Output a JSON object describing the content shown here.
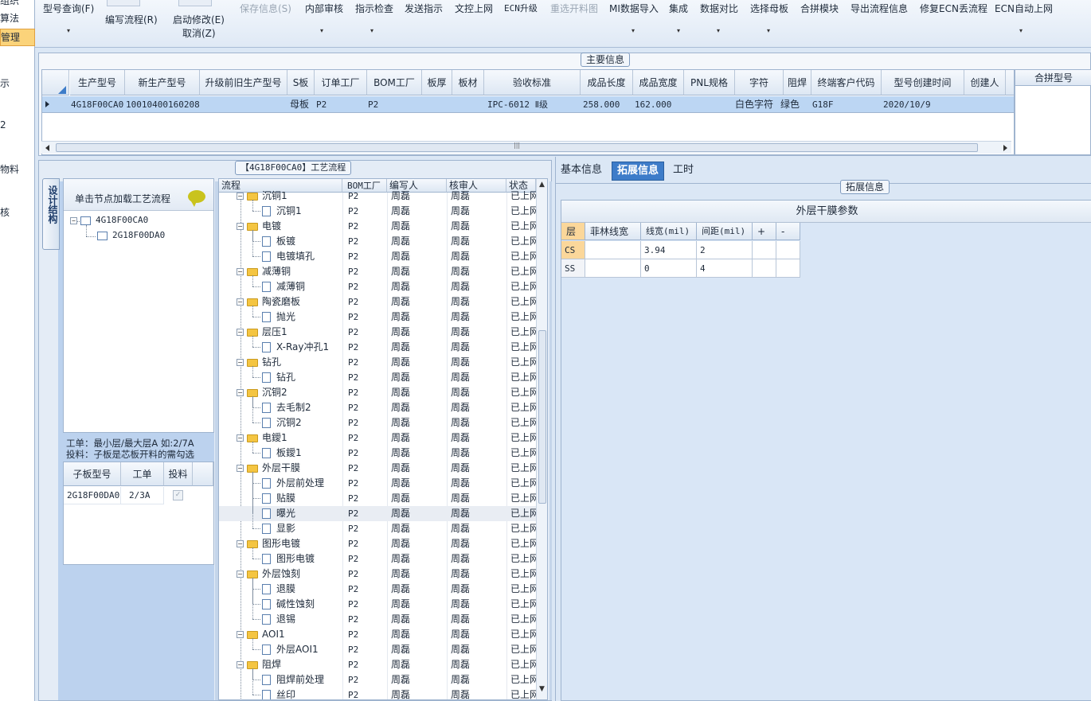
{
  "left_strip": {
    "items": [
      "组织",
      "算法",
      "管理",
      "示",
      "2",
      "物料",
      "核"
    ]
  },
  "toolbar": {
    "model_query": "型号查询(F)",
    "write_flow": "编写流程(R)",
    "start_edit": "启动修改(E)",
    "cancel": "取消(Z)",
    "save_info": "保存信息(S)",
    "internal_audit": "内部审核",
    "instruction_check": "指示检查",
    "send_instruction": "发送指示",
    "doc_control_online": "文控上网",
    "ecn_upgrade": "ECN升级",
    "reselect_cutting": "重选开料图",
    "mi_import": "MI数据导入",
    "integrate": "集成",
    "data_compare": "数据对比",
    "select_mother": "选择母板",
    "merge_module": "合拼模块",
    "export_flow": "导出流程信息",
    "fix_ecn": "修复ECN丢流程",
    "ecn_auto_online": "ECN自动上网",
    "dropdown_glyph": "▾"
  },
  "main_info": {
    "title": "主要信息",
    "columns": [
      "生产型号",
      "新生产型号",
      "升级前旧生产型号",
      "S板",
      "订单工厂",
      "BOM工厂",
      "板厚",
      "板材",
      "验收标准",
      "成品长度",
      "成品宽度",
      "PNL规格",
      "字符",
      "阻焊",
      "终端客户代码",
      "型号创建时间",
      "创建人"
    ],
    "row": {
      "model": "4G18F00CA0",
      "new_model": "10010400160208",
      "s_board": "母板",
      "order_factory": "P2",
      "bom_factory": "P2",
      "standard": "IPC-6012 Ⅱ级",
      "length": "258.000",
      "width": "162.000",
      "char": "白色字符",
      "solder": "绿色",
      "customer_code": "G18F",
      "create_time": "2020/10/9"
    },
    "merge_title": "合拼型号",
    "scroll_grip": "|||"
  },
  "process": {
    "panel_title": "【4G18F00CA0】工艺流程",
    "vertical_tab": "设计结构",
    "tree_header": "单击节点加载工艺流程",
    "tree_root": "4G18F00CA0",
    "tree_child": "2G18F00DA0",
    "tree_toggle": "−",
    "note_line1": "工单：最小层/最大层A 如:2/7A",
    "note_line2": "投料：子板是芯板开料的需勾选",
    "sub_columns": [
      "子板型号",
      "工单",
      "投料"
    ],
    "sub_row": {
      "model": "2G18F00DA0",
      "order": "2/3A",
      "check": "✓"
    },
    "flow_columns": [
      "流程",
      "BOM工厂",
      "编写人",
      "核审人",
      "状态"
    ],
    "flow_toggle": "−",
    "scroll_up": "▲",
    "scroll_down": "▼",
    "flow_rows": [
      {
        "name": "沉铜1",
        "folder": true,
        "factory": "P2",
        "writer": "周磊",
        "reviewer": "周磊",
        "status": "已上网"
      },
      {
        "name": "沉铜1",
        "folder": false,
        "factory": "P2",
        "writer": "周磊",
        "reviewer": "周磊",
        "status": "已上网"
      },
      {
        "name": "电镀",
        "folder": true,
        "factory": "P2",
        "writer": "周磊",
        "reviewer": "周磊",
        "status": "已上网"
      },
      {
        "name": "板镀",
        "folder": false,
        "factory": "P2",
        "writer": "周磊",
        "reviewer": "周磊",
        "status": "已上网"
      },
      {
        "name": "电镀填孔",
        "folder": false,
        "factory": "P2",
        "writer": "周磊",
        "reviewer": "周磊",
        "status": "已上网"
      },
      {
        "name": "减薄铜",
        "folder": true,
        "factory": "P2",
        "writer": "周磊",
        "reviewer": "周磊",
        "status": "已上网"
      },
      {
        "name": "减薄铜",
        "folder": false,
        "factory": "P2",
        "writer": "周磊",
        "reviewer": "周磊",
        "status": "已上网"
      },
      {
        "name": "陶瓷磨板",
        "folder": true,
        "factory": "P2",
        "writer": "周磊",
        "reviewer": "周磊",
        "status": "已上网"
      },
      {
        "name": "抛光",
        "folder": false,
        "factory": "P2",
        "writer": "周磊",
        "reviewer": "周磊",
        "status": "已上网"
      },
      {
        "name": "层压1",
        "folder": true,
        "factory": "P2",
        "writer": "周磊",
        "reviewer": "周磊",
        "status": "已上网"
      },
      {
        "name": "X-Ray冲孔1",
        "folder": false,
        "factory": "P2",
        "writer": "周磊",
        "reviewer": "周磊",
        "status": "已上网"
      },
      {
        "name": "钻孔",
        "folder": true,
        "factory": "P2",
        "writer": "周磊",
        "reviewer": "周磊",
        "status": "已上网"
      },
      {
        "name": "钻孔",
        "folder": false,
        "factory": "P2",
        "writer": "周磊",
        "reviewer": "周磊",
        "status": "已上网"
      },
      {
        "name": "沉铜2",
        "folder": true,
        "factory": "P2",
        "writer": "周磊",
        "reviewer": "周磊",
        "status": "已上网"
      },
      {
        "name": "去毛制2",
        "folder": false,
        "factory": "P2",
        "writer": "周磊",
        "reviewer": "周磊",
        "status": "已上网"
      },
      {
        "name": "沉铜2",
        "folder": false,
        "factory": "P2",
        "writer": "周磊",
        "reviewer": "周磊",
        "status": "已上网"
      },
      {
        "name": "电鑀1",
        "folder": true,
        "factory": "P2",
        "writer": "周磊",
        "reviewer": "周磊",
        "status": "已上网"
      },
      {
        "name": "板鑀1",
        "folder": false,
        "factory": "P2",
        "writer": "周磊",
        "reviewer": "周磊",
        "status": "已上网"
      },
      {
        "name": "外层干膜",
        "folder": true,
        "factory": "P2",
        "writer": "周磊",
        "reviewer": "周磊",
        "status": "已上网"
      },
      {
        "name": "外层前处理",
        "folder": false,
        "factory": "P2",
        "writer": "周磊",
        "reviewer": "周磊",
        "status": "已上网"
      },
      {
        "name": "贴膜",
        "folder": false,
        "factory": "P2",
        "writer": "周磊",
        "reviewer": "周磊",
        "status": "已上网"
      },
      {
        "name": "曝光",
        "folder": false,
        "factory": "P2",
        "writer": "周磊",
        "reviewer": "周磊",
        "status": "已上网",
        "selected": true
      },
      {
        "name": "显影",
        "folder": false,
        "factory": "P2",
        "writer": "周磊",
        "reviewer": "周磊",
        "status": "已上网"
      },
      {
        "name": "图形电镀",
        "folder": true,
        "factory": "P2",
        "writer": "周磊",
        "reviewer": "周磊",
        "status": "已上网"
      },
      {
        "name": "图形电镀",
        "folder": false,
        "factory": "P2",
        "writer": "周磊",
        "reviewer": "周磊",
        "status": "已上网"
      },
      {
        "name": "外层蚀刻",
        "folder": true,
        "factory": "P2",
        "writer": "周磊",
        "reviewer": "周磊",
        "status": "已上网"
      },
      {
        "name": "退膜",
        "folder": false,
        "factory": "P2",
        "writer": "周磊",
        "reviewer": "周磊",
        "status": "已上网"
      },
      {
        "name": "碱性蚀刻",
        "folder": false,
        "factory": "P2",
        "writer": "周磊",
        "reviewer": "周磊",
        "status": "已上网"
      },
      {
        "name": "退锡",
        "folder": false,
        "factory": "P2",
        "writer": "周磊",
        "reviewer": "周磊",
        "status": "已上网"
      },
      {
        "name": "AOI1",
        "folder": true,
        "factory": "P2",
        "writer": "周磊",
        "reviewer": "周磊",
        "status": "已上网"
      },
      {
        "name": "外层AOI1",
        "folder": false,
        "factory": "P2",
        "writer": "周磊",
        "reviewer": "周磊",
        "status": "已上网"
      },
      {
        "name": "阻焊",
        "folder": true,
        "factory": "P2",
        "writer": "周磊",
        "reviewer": "周磊",
        "status": "已上网"
      },
      {
        "name": "阻焊前处理",
        "folder": false,
        "factory": "P2",
        "writer": "周磊",
        "reviewer": "周磊",
        "status": "已上网"
      },
      {
        "name": "丝印",
        "folder": false,
        "factory": "P2",
        "writer": "周磊",
        "reviewer": "周磊",
        "status": "已上网"
      }
    ]
  },
  "right": {
    "tabs": [
      "基本信息",
      "拓展信息",
      "工时"
    ],
    "ext_title": "拓展信息",
    "film_title": "外层干膜参数",
    "columns": [
      "层",
      "菲林线宽",
      "线宽(mil)",
      "间距(mil)",
      "+",
      "-"
    ],
    "rows": [
      {
        "layer": "CS",
        "filin": "",
        "width": "3.94",
        "spacing": "2"
      },
      {
        "layer": "SS",
        "filin": "",
        "width": "0",
        "spacing": "4"
      }
    ]
  }
}
